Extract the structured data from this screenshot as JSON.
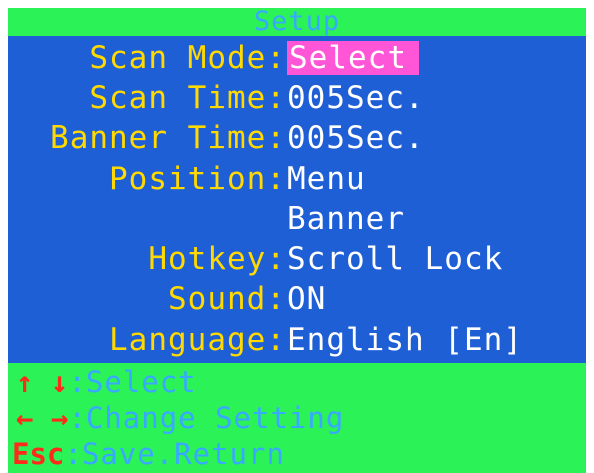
{
  "title": "Setup",
  "settings": [
    {
      "label": "Scan Mode:",
      "value": "Select"
    },
    {
      "label": "Scan Time:",
      "value": "005Sec."
    },
    {
      "label": "Banner Time:",
      "value": "005Sec."
    },
    {
      "label": "Position:",
      "value": "Menu"
    },
    {
      "label": "",
      "value": "Banner"
    },
    {
      "label": "Hotkey:",
      "value": "Scroll Lock"
    },
    {
      "label": "Sound:",
      "value": "ON"
    },
    {
      "label": "Language:",
      "value": "English [En]"
    }
  ],
  "hints": [
    {
      "keys": [
        "arrow-up-icon",
        "arrow-down-icon"
      ],
      "key_glyphs": "↑ ↓",
      "sep": ":",
      "desc": "Select"
    },
    {
      "keys": [
        "arrow-left-icon",
        "arrow-right-icon"
      ],
      "key_glyphs": "← →",
      "sep": ":",
      "desc": "Change Setting"
    },
    {
      "key_text": "Esc",
      "sep": ":",
      "desc": "Save.Return"
    }
  ],
  "colors": {
    "panel_blue": "#1f5fd6",
    "bar_green": "#2bf257",
    "label_yellow": "#ffd900",
    "value_white": "#ffffff",
    "highlight_pink": "#ff55d7",
    "key_red": "#ff2a18",
    "hint_blue": "#39a8ff"
  }
}
